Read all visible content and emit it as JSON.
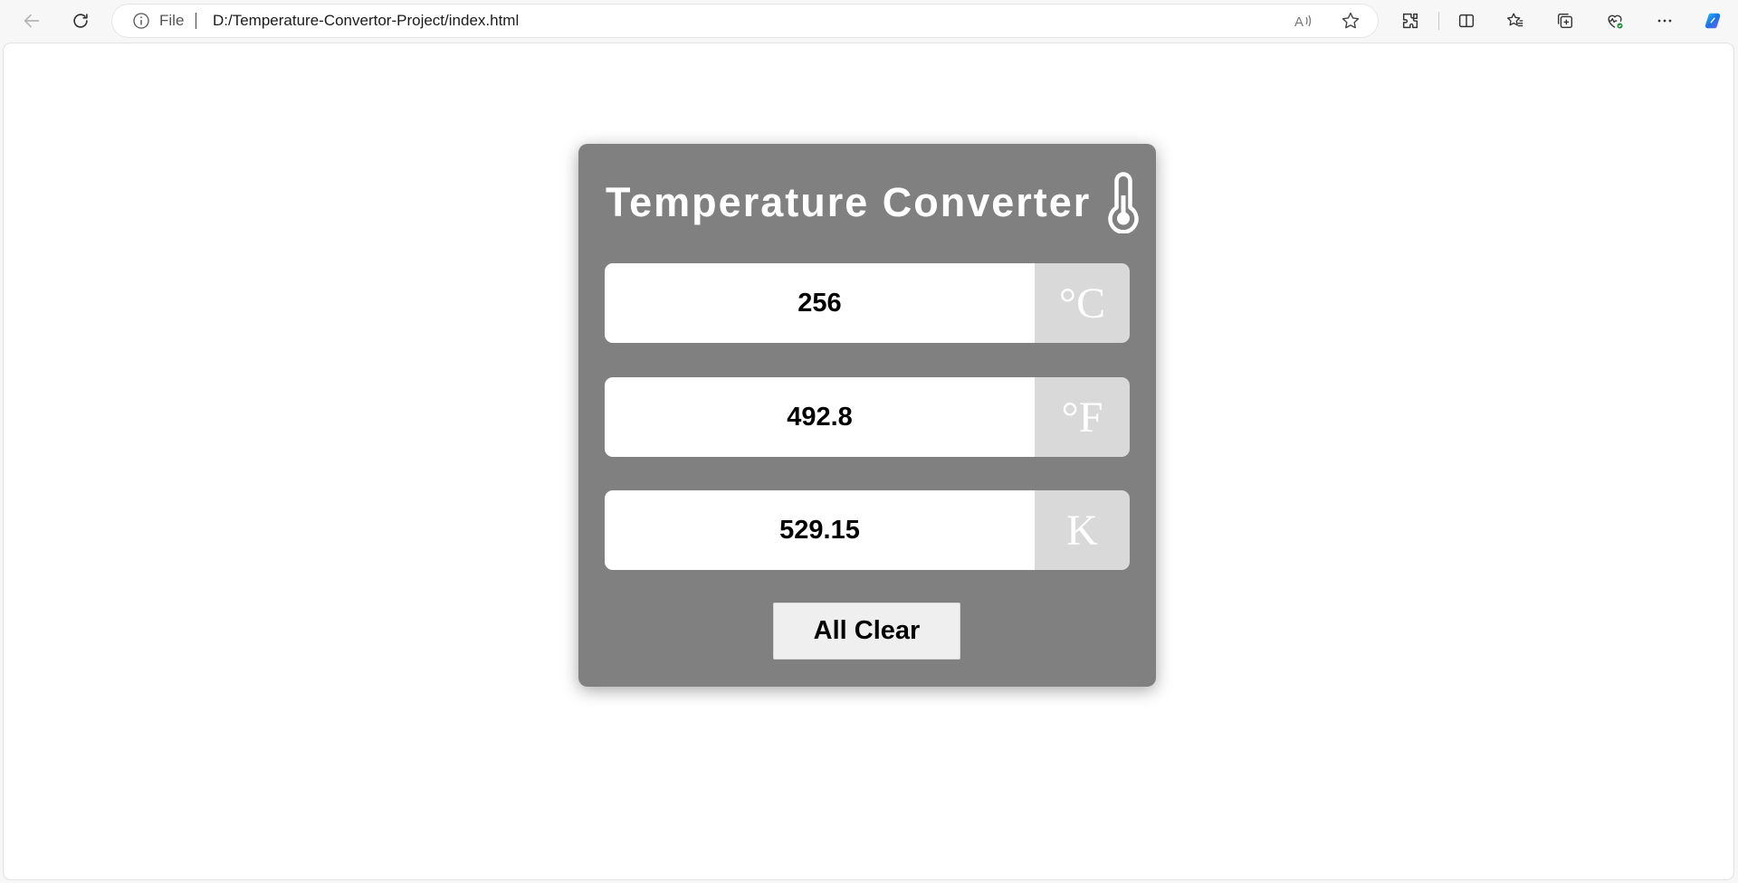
{
  "browser": {
    "address_scheme_label": "File",
    "url": "D:/Temperature-Convertor-Project/index.html"
  },
  "icons": {
    "back": "back-arrow-icon",
    "refresh": "refresh-icon",
    "info": "info-icon",
    "read_aloud": "read-aloud-icon",
    "favorite": "favorite-star-icon",
    "extensions": "extensions-icon",
    "split_screen": "split-screen-icon",
    "favorites": "favorites-icon",
    "collections": "collections-icon",
    "browser_essentials": "browser-essentials-icon",
    "more": "more-options-icon",
    "copilot": "copilot-icon",
    "thermometer": "thermometer-icon"
  },
  "converter": {
    "title": "Temperature Converter",
    "celsius": {
      "value": "256",
      "unit": "°C"
    },
    "fahrenheit": {
      "value": "492.8",
      "unit": "°F"
    },
    "kelvin": {
      "value": "529.15",
      "unit": "K"
    },
    "clear_button_label": "All Clear"
  },
  "colors": {
    "card_background": "#808080",
    "unit_box": "#d9d9d9",
    "copilot_blue": "#1a73e8"
  }
}
